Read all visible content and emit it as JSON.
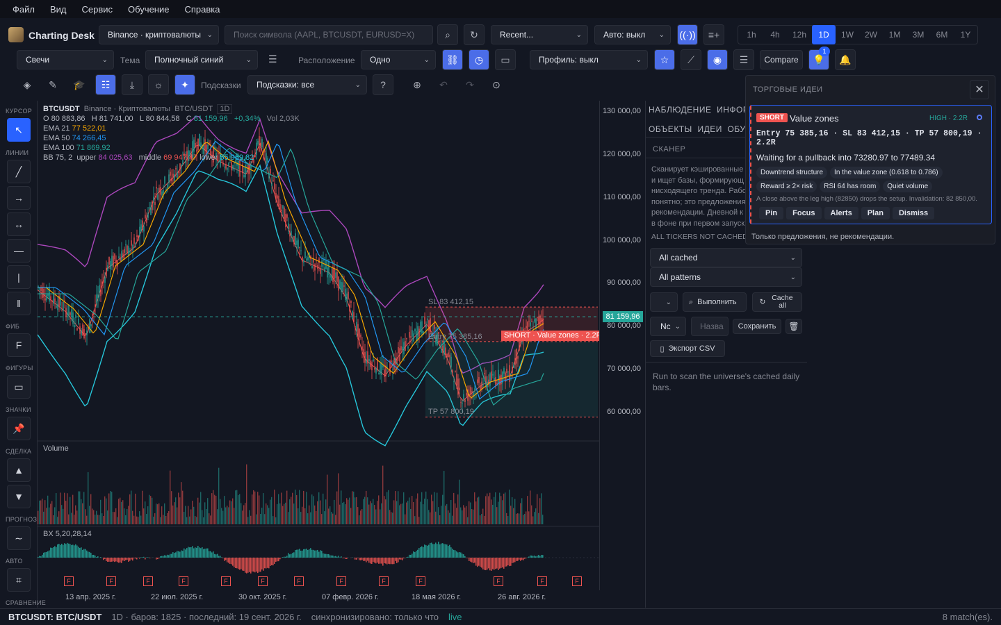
{
  "menu": [
    "Файл",
    "Вид",
    "Сервис",
    "Обучение",
    "Справка"
  ],
  "app": {
    "title": "Charting Desk"
  },
  "toolbar1": {
    "exchange": "Binance · криптовалюты",
    "search_placeholder": "Поиск символа (AAPL, BTCUSDT, EURUSD=X)",
    "recent": "Recent...",
    "auto": "Авто: выкл",
    "timeframes": [
      "1h",
      "4h",
      "12h",
      "1D",
      "1W",
      "2W",
      "1M",
      "3M",
      "6M",
      "1Y"
    ],
    "active_tf": "1D"
  },
  "toolbar2": {
    "chart_type": "Свечи",
    "theme_label": "Тема",
    "theme": "Полночный синий",
    "layout_label": "Расположение",
    "layout": "Одно",
    "profile": "Профиль: выкл",
    "compare": "Compare",
    "badge": "1"
  },
  "toolbar3": {
    "hints_label": "Подсказки",
    "hints": "Подсказки: все"
  },
  "left_tools": {
    "groups": [
      "КУРСОР",
      "ЛИНИИ",
      "ФИБ",
      "ФИГУРЫ",
      "ЗНАЧКИ",
      "СДЕЛКА",
      "ПРОГНОЗ",
      "АВТО",
      "СРАВНЕНИЕ"
    ],
    "fib_label": "F"
  },
  "legend": {
    "symbol": "BTCUSDT",
    "exchange": "Binance · Криптовалюты",
    "pair": "BTC/USDT",
    "interval": "1D",
    "ohlc": {
      "o": "O 80 883,86",
      "h": "H 81 741,00",
      "l": "L 80 844,58",
      "c_label": "C",
      "c": "81 159,96",
      "chg": "+0,34%",
      "vol": "Vol 2,03K"
    },
    "ema21": {
      "label": "EMA 21",
      "value": "77 522,01",
      "color": "#f7a600"
    },
    "ema50": {
      "label": "EMA 50",
      "value": "74 266,45",
      "color": "#2196f3"
    },
    "ema100": {
      "label": "EMA 100",
      "value": "71 869,92",
      "color": "#26a69a"
    },
    "bb": {
      "label": "BB 75, 2",
      "upper_label": "upper",
      "upper": "84 025,63",
      "middle_label": "middle",
      "middle": "69 947,47",
      "lower_label": "lower",
      "lower": "55 969,82"
    }
  },
  "price_axis": [
    "130 000,00",
    "120 000,00",
    "110 000,00",
    "100 000,00",
    "90 000,00",
    "80 000,00",
    "70 000,00",
    "60 000,00"
  ],
  "last_price": "81 159,96",
  "trade_overlay": {
    "sl": "SL 83 412,15",
    "entry": "Entry 75 385,16",
    "tp": "TP 57 800,19",
    "tag": "SHORT · Value zones · 2.2R"
  },
  "panes": {
    "volume": "Volume",
    "bx": "BX 5,20,28,14",
    "f_marker": "F"
  },
  "time_axis": [
    "13 апр. 2025 г.",
    "22 июл. 2025 г.",
    "30 окт. 2025 г.",
    "07 февр. 2026 г.",
    "18 мая 2026 г.",
    "26 авг. 2026 г."
  ],
  "side_panel": {
    "tabs_row1": [
      "НАБЛЮДЕНИЕ",
      "ИНФОРМ"
    ],
    "tabs_row2": [
      "ОБЪЕКТЫ",
      "ИДЕИ",
      "ОБУЧ"
    ],
    "section": "СКАНЕР",
    "desc_lines": [
      "Сканирует кэшированные",
      "и ищет базы, формирующ",
      "нисходящего тренда. Рабо",
      "понятно; это предложения",
      "рекомендации. Дневной к",
      "в фоне при первом запуск"
    ],
    "not_cached": "ALL TICKERS NOT CACHED Y",
    "filter1": "All cached",
    "filter2": "All patterns",
    "run": "Выполнить",
    "cache_all": "Cache all",
    "name_sel": "Nc",
    "name_placeholder": "Назва",
    "save": "Сохранить",
    "export": "Экспорт CSV",
    "empty": "Run to scan the universe's cached daily bars."
  },
  "ideas_popup": {
    "title": "ТОРГОВЫЕ ИДЕИ",
    "side": "SHORT",
    "name": "Value zones",
    "grade": "HIGH · 2.2R",
    "levels": "Entry 75 385,16 · SL 83 412,15 · TP 57 800,19 · 2.2R",
    "waiting": "Waiting for a pullback into 73280.97 to 77489.34",
    "chips_row1": [
      "Downtrend structure",
      "In the value zone (0.618 to 0.786)"
    ],
    "chips_row2": [
      "Reward ≥ 2× risk",
      "RSI 64 has room",
      "Quiet volume"
    ],
    "note": "A close above the leg high (82850) drops the setup. Invalidation: 82 850,00.",
    "actions": [
      "Pin",
      "Focus",
      "Alerts",
      "Plan",
      "Dismiss"
    ],
    "footer": "Только предложения, не рекомендации."
  },
  "status": {
    "symbol": "BTCUSDT: BTC/USDT",
    "info": "1D · баров: 1825 · последний: 19 сент. 2026 г.",
    "sync": "синхронизировано: только что",
    "live": "live",
    "matches": "8 match(es)."
  },
  "colors": {
    "up": "#26a69a",
    "down": "#ef5350",
    "accent": "#2962ff",
    "bb": "#ab47bc",
    "bg": "#131722"
  }
}
